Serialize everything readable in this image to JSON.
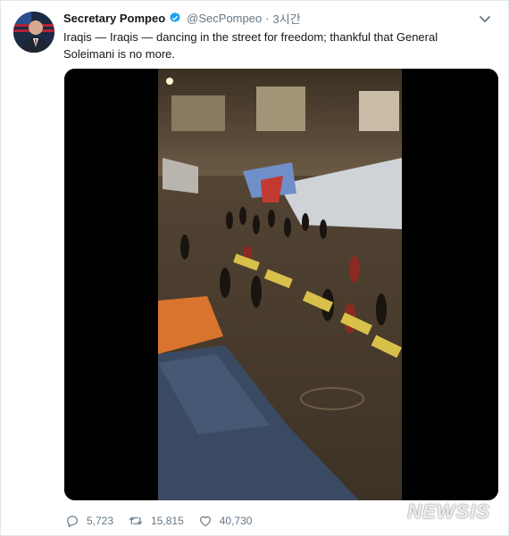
{
  "tweet": {
    "author_name": "Secretary Pompeo",
    "handle": "@SecPompeo",
    "separator": "·",
    "time": "3시간",
    "text": "Iraqis — Iraqis — dancing in the street for freedom; thankful that General Soleimani is no more."
  },
  "actions": {
    "replies": "5,723",
    "retweets": "15,815",
    "likes": "40,730"
  },
  "watermark": "NEWSIS",
  "colors": {
    "accent": "#1da1f2",
    "muted": "#657786",
    "text": "#14171a"
  },
  "icons": {
    "verified": "verified-badge-icon",
    "caret": "chevron-down-icon",
    "reply": "reply-icon",
    "retweet": "retweet-icon",
    "like": "heart-icon"
  }
}
